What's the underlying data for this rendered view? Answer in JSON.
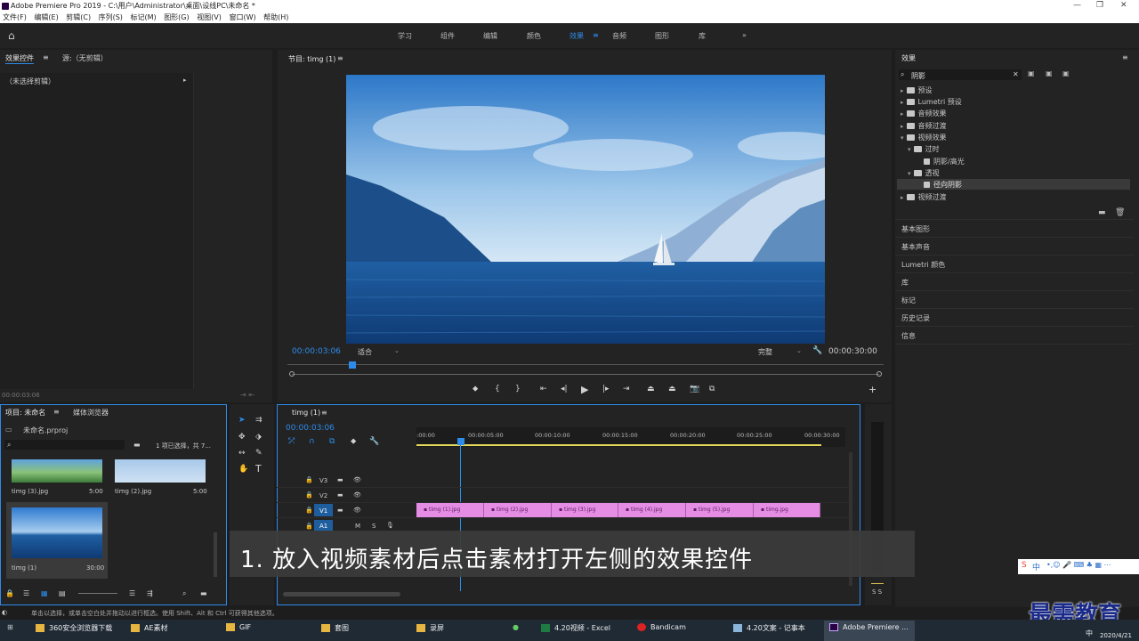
{
  "window": {
    "title": "Adobe Premiere Pro 2019 - C:\\用户\\Administrator\\桌面\\设线PC\\未命名 *"
  },
  "menu": [
    "文件(F)",
    "编辑(E)",
    "剪辑(C)",
    "序列(S)",
    "标记(M)",
    "图形(G)",
    "视图(V)",
    "窗口(W)",
    "帮助(H)"
  ],
  "workspaces": [
    "学习",
    "组件",
    "编辑",
    "颜色",
    "效果",
    "音频",
    "图形",
    "库"
  ],
  "active_workspace": "效果",
  "effect_controls": {
    "tab": "效果控件",
    "source": "源:（无剪辑）",
    "no_clip": "（未选择剪辑）",
    "time": "00:00:03:06"
  },
  "program": {
    "tab": "节目: timg (1)",
    "timecode": "00:00:03:06",
    "fit": "适合",
    "quality": "完整",
    "duration": "00:00:30:00"
  },
  "effects_panel": {
    "title": "效果",
    "search_value": "阴影",
    "tree": [
      {
        "label": "预设",
        "level": 0
      },
      {
        "label": "Lumetri 预设",
        "level": 0
      },
      {
        "label": "音频效果",
        "level": 0
      },
      {
        "label": "音频过渡",
        "level": 0
      },
      {
        "label": "视频效果",
        "level": 0
      },
      {
        "label": "过时",
        "level": 1
      },
      {
        "label": "阴影/高光",
        "level": 2
      },
      {
        "label": "透视",
        "level": 1
      },
      {
        "label": "径向阴影",
        "level": 2
      },
      {
        "label": "视频过渡",
        "level": 0
      }
    ],
    "sections": [
      "基本图形",
      "基本声音",
      "Lumetri 颜色",
      "库",
      "标记",
      "历史记录",
      "信息"
    ]
  },
  "project": {
    "tab": "项目: 未命名",
    "browser_tab": "媒体浏览器",
    "file": "未命名.prproj",
    "selection": "1 项已选择，共 7...",
    "items": [
      {
        "name": "timg (3).jpg",
        "duration": "5:00"
      },
      {
        "name": "timg (2).jpg",
        "duration": "5:00"
      },
      {
        "name": "timg (1)",
        "duration": "30:00"
      }
    ]
  },
  "timeline": {
    "tab": "timg (1)",
    "timecode": "00:00:03:06",
    "ruler": [
      ":00:00",
      "00:00:05:00",
      "00:00:10:00",
      "00:00:15:00",
      "00:00:20:00",
      "00:00:25:00",
      "00:00:30:00"
    ],
    "tracks": [
      "V3",
      "V2",
      "V1",
      "A1"
    ],
    "clips": [
      "timg (1).jpg",
      "timg (2).jpg",
      "timg (3).jpg",
      "timg (4).jpg",
      "timg (5).jpg",
      "timg.jpg"
    ]
  },
  "status_bar": "单击以选择，或单击空白处并拖动以进行框选。使用 Shift、Alt 和 Ctrl 可获得其他选项。",
  "subtitle": "1. 放入视频素材后点击素材打开左侧的效果控件",
  "watermark": "最需教育",
  "taskbar": {
    "items": [
      "360安全浏览器下载",
      "AE素材",
      "GIF",
      "套图",
      "录屏",
      "4.20视频 - Excel",
      "Bandicam",
      "4.20文案 - 记事本",
      "Adobe Premiere ..."
    ],
    "date": "2020/4/21",
    "ime": "中"
  },
  "colors": {
    "accent": "#2d8ceb",
    "clip": "#e58ce5",
    "panel": "#232323"
  }
}
